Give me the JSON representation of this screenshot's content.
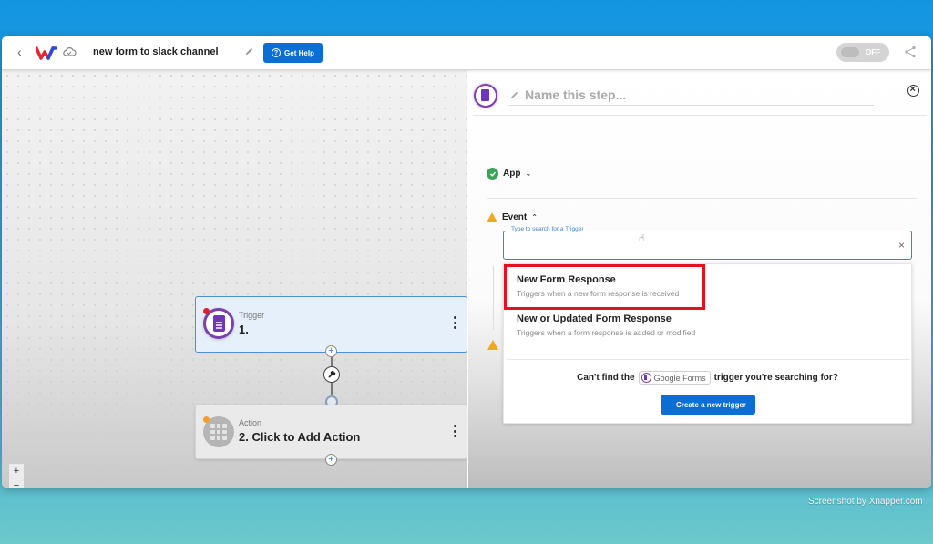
{
  "topbar": {
    "back_icon": "chevron-left-icon",
    "logo": "workflow-logo",
    "cloud_icon": "cloud-icon",
    "title": "new form to slack channel",
    "edit_icon": "pencil-icon",
    "help_button": "Get Help",
    "toggle_label": "OFF",
    "toggle_state": "off",
    "share_icon": "share-icon"
  },
  "canvas": {
    "trigger_node": {
      "label": "Trigger",
      "title": "1.",
      "app_icon": "google-forms-icon",
      "status_color": "#d9232e"
    },
    "action_node": {
      "label": "Action",
      "title": "2. Click to Add Action",
      "app_icon": "grid-apps-icon",
      "status_color": "#f0a030"
    },
    "zoom_controls": [
      "+",
      "−",
      "⛶",
      "🔒"
    ]
  },
  "panel": {
    "step_name_placeholder": "Name this step...",
    "app_section": {
      "label": "App",
      "status": "complete"
    },
    "event_section": {
      "label": "Event",
      "status": "warning"
    },
    "search": {
      "legend": "Type to search for a Trigger",
      "value": "",
      "clear": "×"
    },
    "options": [
      {
        "title": "New Form Response",
        "description": "Triggers when a new form response is received",
        "highlighted": true
      },
      {
        "title": "New or Updated Form Response",
        "description": "Triggers when a form response is added or modified",
        "highlighted": false
      }
    ],
    "cant_find": {
      "prefix": "Can't find the",
      "app_name": "Google Forms",
      "suffix": "trigger you're searching for?"
    },
    "create_button": "+ Create a new trigger"
  },
  "colors": {
    "accent": "#0b6ed6",
    "highlight": "#e5111a",
    "forms_purple": "#6f36b8",
    "success": "#3aa55a",
    "warning": "#f4a81e"
  },
  "watermark": "Screenshot by Xnapper.com"
}
